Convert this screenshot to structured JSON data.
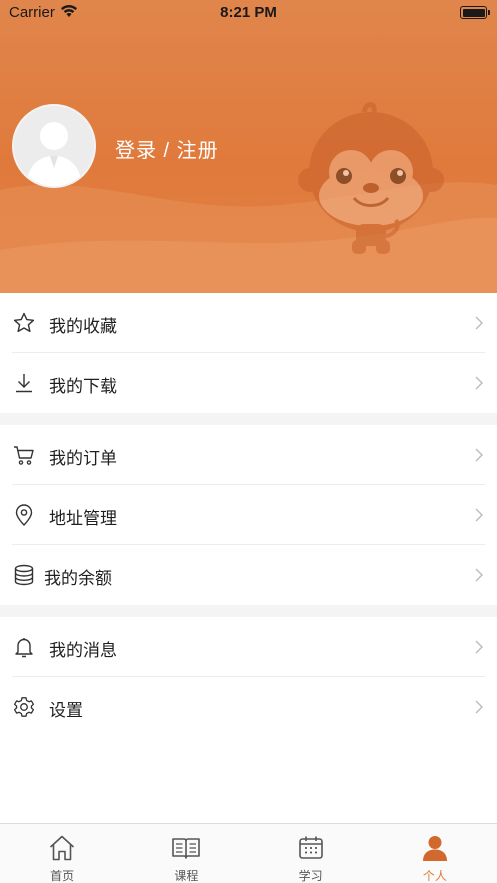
{
  "status_bar": {
    "carrier": "Carrier",
    "time": "8:21 PM"
  },
  "profile": {
    "login_label": "登录 / 注册",
    "avatar": "default-user-avatar",
    "mascot": "monkey-mascot"
  },
  "colors": {
    "accent": "#e07a3c",
    "header_top": "#e0864c",
    "header_bottom": "#e27f42",
    "separator": "#f4f4f4"
  },
  "menu_groups": [
    {
      "items": [
        {
          "icon": "star-icon",
          "label": "我的收藏"
        },
        {
          "icon": "download-icon",
          "label": "我的下载"
        }
      ]
    },
    {
      "items": [
        {
          "icon": "cart-icon",
          "label": "我的订单"
        },
        {
          "icon": "location-pin-icon",
          "label": "地址管理"
        },
        {
          "icon": "database-icon",
          "label": "我的余额"
        }
      ]
    },
    {
      "items": [
        {
          "icon": "bell-icon",
          "label": "我的消息"
        },
        {
          "icon": "gear-icon",
          "label": "设置"
        }
      ]
    }
  ],
  "tabbar": {
    "tabs": [
      {
        "icon": "home-icon",
        "label": "首页",
        "active": false
      },
      {
        "icon": "book-icon",
        "label": "课程",
        "active": false
      },
      {
        "icon": "calendar-icon",
        "label": "学习",
        "active": false
      },
      {
        "icon": "person-icon",
        "label": "个人",
        "active": true
      }
    ]
  }
}
